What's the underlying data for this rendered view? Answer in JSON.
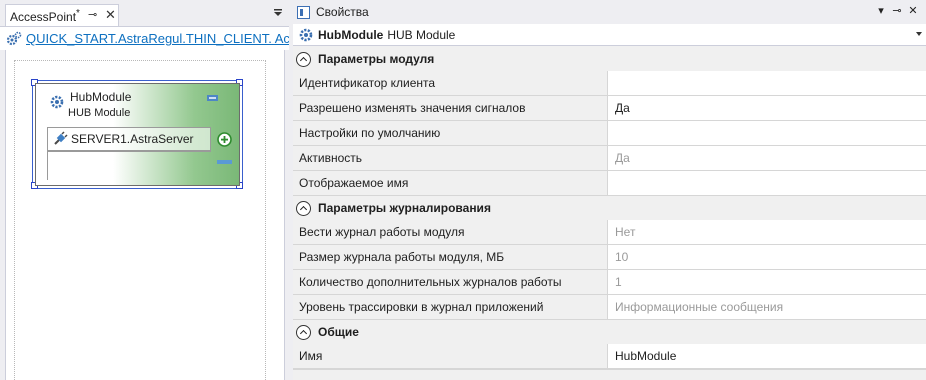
{
  "left_panel": {
    "tab": {
      "title": "AccessPoint",
      "modified_marker": "*",
      "pin_icon": "pin-icon",
      "close_icon": "close-icon"
    },
    "path": {
      "icon": "gear-icon",
      "link_text": "QUICK_START.AstraRegul.THIN_CLIENT. Ac"
    },
    "node": {
      "title": "HubModule",
      "subtitle": "HUB Module",
      "server_label": "SERVER1.AstraServer",
      "add_icon": "plus-circle-icon",
      "remove_icon": "minus-icon"
    }
  },
  "right_panel": {
    "title": "Свойства",
    "selected_object": {
      "name": "HubModule",
      "type": "HUB Module"
    },
    "categories": [
      {
        "label": "Параметры модуля",
        "rows": [
          {
            "name": "Идентификатор клиента",
            "value": "",
            "disabled": false
          },
          {
            "name": "Разрешено изменять значения сигналов",
            "value": "Да",
            "disabled": false
          },
          {
            "name": "Настройки по умолчанию",
            "value": "",
            "disabled": false
          },
          {
            "name": "Активность",
            "value": "Да",
            "disabled": true
          },
          {
            "name": "Отображаемое имя",
            "value": "",
            "disabled": false
          }
        ]
      },
      {
        "label": "Параметры журналирования",
        "rows": [
          {
            "name": "Вести журнал работы модуля",
            "value": "Нет",
            "disabled": true
          },
          {
            "name": "Размер журнала работы модуля, МБ",
            "value": "10",
            "disabled": true
          },
          {
            "name": "Количество дополнительных журналов работы",
            "value": "1",
            "disabled": true
          },
          {
            "name": "Уровень трассировки в журнал приложений",
            "value": "Информационные сообщения",
            "disabled": true
          }
        ]
      },
      {
        "label": "Общие",
        "rows": [
          {
            "name": "Имя",
            "value": "HubModule",
            "disabled": false
          }
        ]
      }
    ]
  },
  "colors": {
    "accent_link": "#0e70c0",
    "selection_handle": "#2a44c8",
    "node_gradient_end": "#7ab877",
    "disabled_text": "#9a9a9a"
  }
}
